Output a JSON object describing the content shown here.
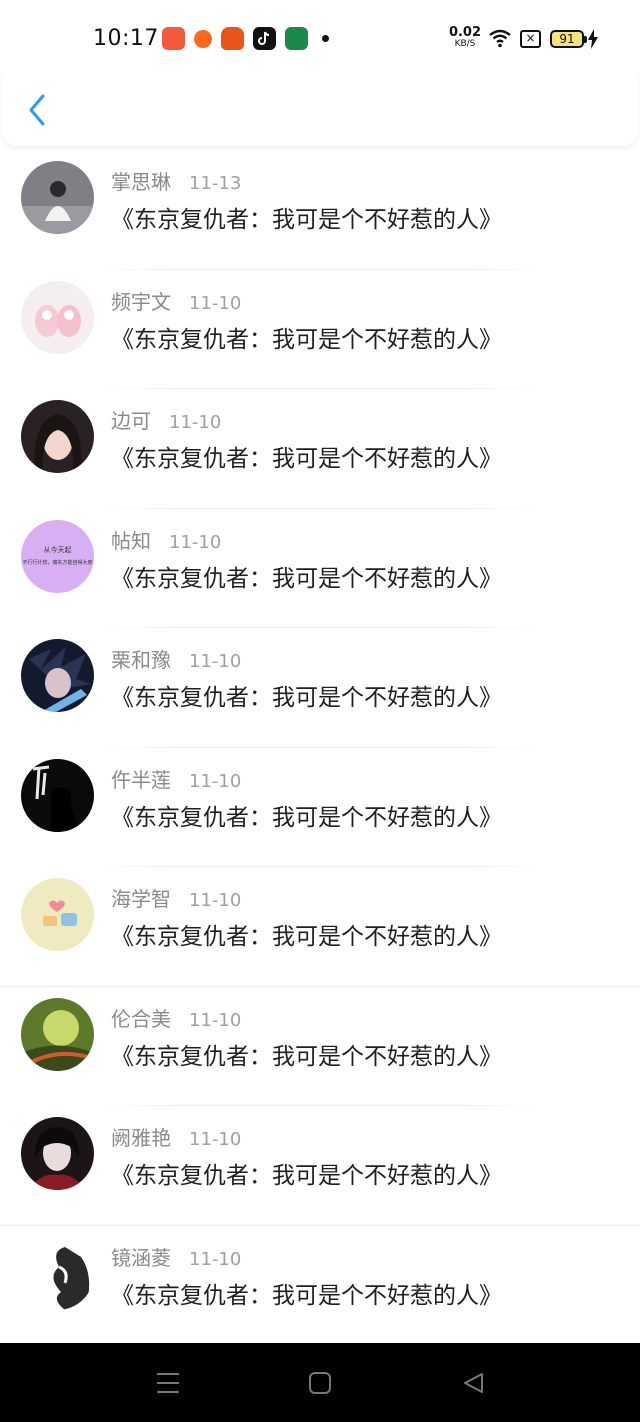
{
  "status_bar": {
    "time": "10:17",
    "net_speed": "0.02",
    "net_unit": "KB/S",
    "battery": "91",
    "sim": "×",
    "app_icons": [
      "video-app-icon",
      "orange-app-icon",
      "pumpkin-app-icon",
      "tiktok-icon",
      "green-app-icon"
    ]
  },
  "header": {
    "back_icon": "chevron-left-icon"
  },
  "colors": {
    "accent": "#2a9bf0",
    "name_gray": "#8a8a8a",
    "title_text": "#1f1f1f"
  },
  "items": [
    {
      "name": "掌思琳",
      "date": "11-13",
      "title": "《东京复仇者：我可是个不好惹的人》"
    },
    {
      "name": "频宇文",
      "date": "11-10",
      "title": "《东京复仇者：我可是个不好惹的人》"
    },
    {
      "name": "边可",
      "date": "11-10",
      "title": "《东京复仇者：我可是个不好惹的人》"
    },
    {
      "name": "帖知",
      "date": "11-10",
      "title": "《东京复仇者：我可是个不好惹的人》",
      "avatar_text_1": "从今天起",
      "avatar_text_2": "不行行计较，痛失方能自得大度"
    },
    {
      "name": "栗和豫",
      "date": "11-10",
      "title": "《东京复仇者：我可是个不好惹的人》"
    },
    {
      "name": "仵半莲",
      "date": "11-10",
      "title": "《东京复仇者：我可是个不好惹的人》"
    },
    {
      "name": "海学智",
      "date": "11-10",
      "title": "《东京复仇者：我可是个不好惹的人》"
    },
    {
      "name": "伦合美",
      "date": "11-10",
      "title": "《东京复仇者：我可是个不好惹的人》"
    },
    {
      "name": "阙雅艳",
      "date": "11-10",
      "title": "《东京复仇者：我可是个不好惹的人》"
    },
    {
      "name": "镜涵菱",
      "date": "11-10",
      "title": "《东京复仇者：我可是个不好惹的人》"
    }
  ],
  "nav": {
    "menu_icon": "menu-icon",
    "home_icon": "home-square-icon",
    "back_icon": "back-triangle-icon"
  }
}
